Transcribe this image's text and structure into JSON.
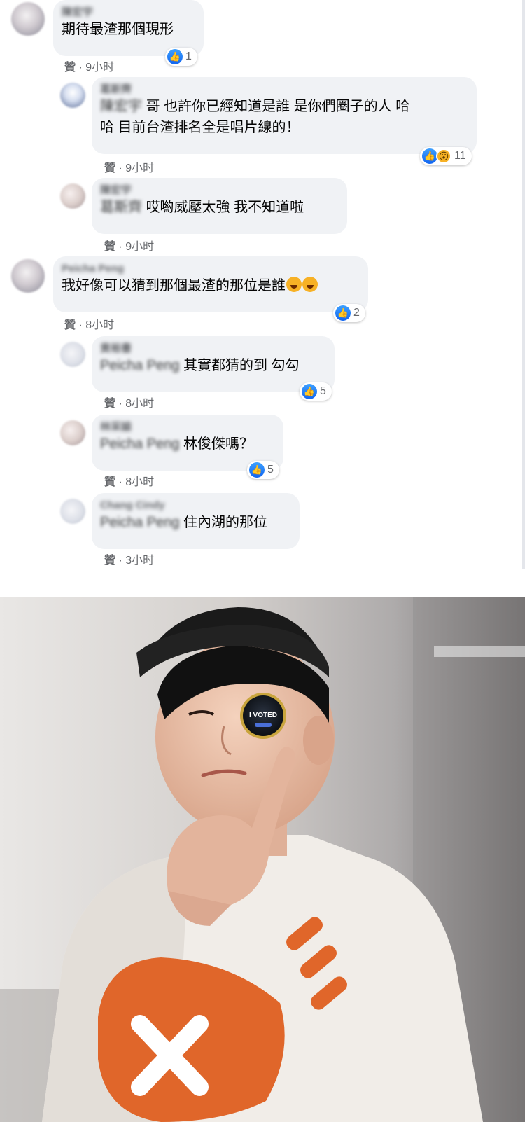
{
  "comments": [
    {
      "author": "陳宏宇",
      "text": "期待最渣那個現形",
      "like": "贊",
      "time": "9小时",
      "reaction_count": "1"
    },
    {
      "author": "葛斯齊",
      "mention": "陳宏宇",
      "text_line1": "哥 也許你已經知道是誰 是你們圈子的人 哈",
      "text_line2": "哈 目前台渣排名全是唱片線的！",
      "like": "贊",
      "time": "9小时",
      "reaction_count": "11"
    },
    {
      "author": "陳宏宇",
      "mention": "葛斯齊",
      "text": "哎喲威壓太強 我不知道啦",
      "like": "贊",
      "time": "9小时"
    },
    {
      "author": "Peicha Peng",
      "text": "我好像可以猜到那個最渣的那位是誰",
      "like": "贊",
      "time": "8小时",
      "reaction_count": "2"
    },
    {
      "author": "黄裕書",
      "mention": "Peicha Peng",
      "text": "其實都猜的到 勾勾",
      "like": "贊",
      "time": "8小时",
      "reaction_count": "5"
    },
    {
      "author": "林采諭",
      "mention": "Peicha Peng",
      "text": "林俊傑嗎？",
      "like": "贊",
      "time": "8小时",
      "reaction_count": "5"
    },
    {
      "author": "Chang Cindy",
      "mention": "Peicha Peng",
      "text": "住內湖的那位",
      "like": "贊",
      "time": "3小时"
    }
  ],
  "photo": {
    "sticker_text": "I VOTED"
  },
  "icons": {
    "like": "thumbs-up-icon",
    "wow": "wow-icon",
    "laugh": "laugh-emoji-icon"
  },
  "colors": {
    "bubble": "#f0f2f5",
    "meta_text": "#65676b",
    "like_blue": "#1877f2"
  }
}
